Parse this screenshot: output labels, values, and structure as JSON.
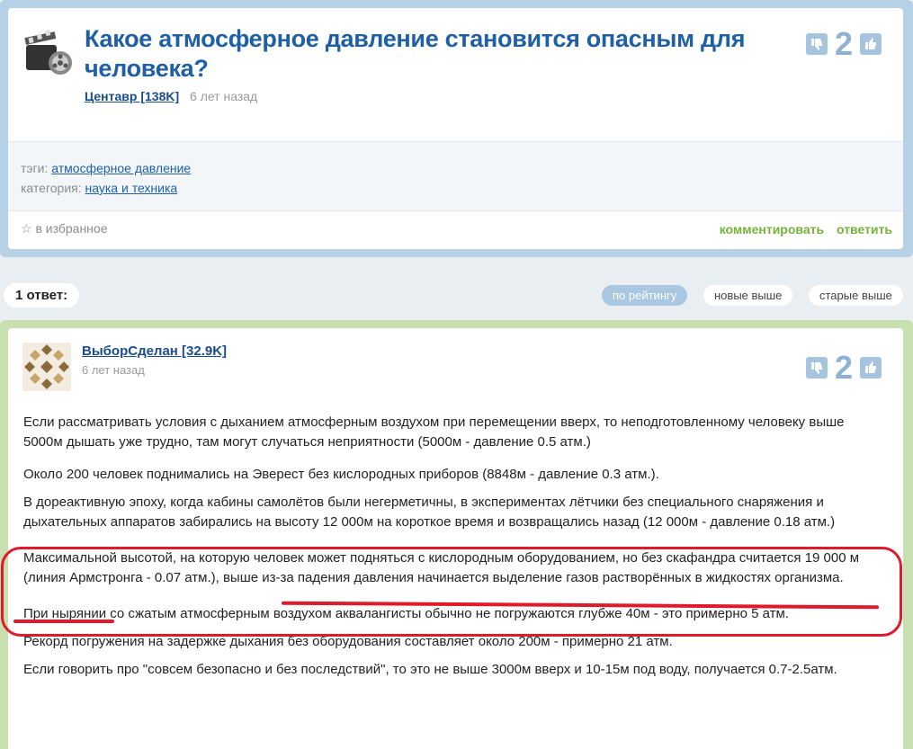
{
  "question": {
    "title": "Какое атмосферное давление становится опасным для человека?",
    "author": "Центавр [138K]",
    "time": "6 лет назад",
    "votes": "2",
    "tags_label": "тэги:",
    "tag": "атмосферное давление",
    "category_label": "категория:",
    "category": "наука и техника",
    "favorite": "☆ в избранное",
    "comment": "комментировать",
    "reply": "ответить"
  },
  "answers_bar": {
    "count": "1 ответ:",
    "sort_rating": "по рейтингу",
    "sort_new": "новые выше",
    "sort_old": "старые выше"
  },
  "answer": {
    "author": "ВыборСделан [32.9K]",
    "time": "6 лет назад",
    "votes": "2",
    "paragraphs": [
      "Если рассматривать условия с дыханием атмосферным воздухом при перемещении вверх, то неподготовленному человеку выше 5000м дышать уже трудно, там могут случаться неприятности (5000м - давление 0.5 атм.)",
      "Около 200 человек поднимались на Эверест без кислородных приборов (8848м - давление 0.3 атм.).",
      "В дореактивную эпоху, когда кабины самолётов были негерметичны, в экспериментах лётчики без специального снаряжения и дыхательных аппаратов забирались на высоту 12 000м на короткое время и возвращались назад (12 000м - давление 0.18 атм.)",
      "Максимальной высотой, на которую человек может подняться с кислородным оборудованием, но без скафандра считается 19 000 м (линия Армстронга - 0.07 атм.), выше из-за падения давления начинается выделение газов растворённых в жидкостях организма.",
      "При нырянии со сжатым атмосферным воздухом аквалангисты обычно не погружаются глубже 40м - это примерно 5 атм.",
      "Рекорд погружения на задержке дыхания без оборудования составляет около 200м - примерно 21 атм.",
      "Если говорить про \"совсем безопасно и без последствий\", то это не выше 3000м вверх и 10-15м под воду, получается 0.7-2.5атм."
    ]
  },
  "colors": {
    "title_blue": "#1f5fa6",
    "action_green": "#76b23a",
    "highlight_red": "#e0192b",
    "question_border": "#b6d0e6",
    "answer_border": "#c8dfb0"
  },
  "icons": [
    "film-reel-avatar",
    "thumbs-down-icon",
    "thumbs-up-icon",
    "star-icon",
    "pattern-avatar"
  ]
}
